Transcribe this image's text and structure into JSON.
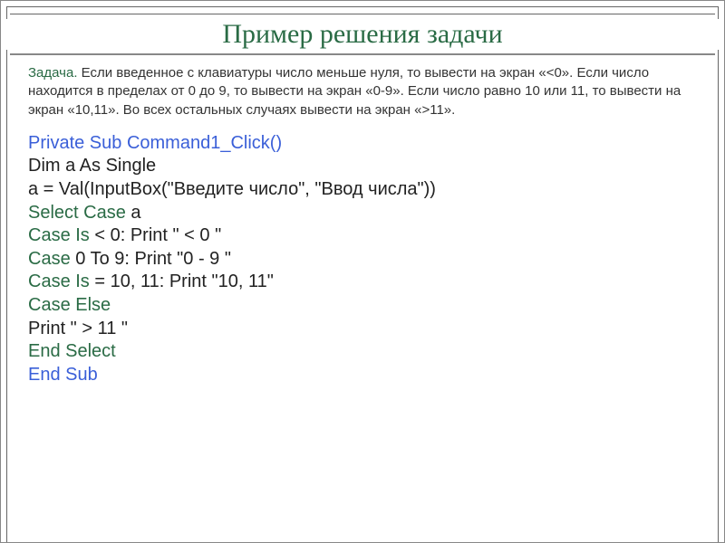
{
  "title": "Пример решения задачи",
  "task": {
    "label": "Задача.",
    "body": " Если введенное с клавиатуры число меньше нуля, то вывести на экран «<0». Если число находится в пределах от 0 до 9, то вывести на       экран «0-9». Если число равно 10 или 11, то вывести на экран «10,11».      Во всех остальных случаях вывести на экран «>11»."
  },
  "code": {
    "line1": "Private Sub Command1_Click()",
    "line2": "Dim a As Single",
    "line3": "a = Val(InputBox(\"Введите число\", \"Ввод числа\"))",
    "line4_a": "Select Case",
    "line4_b": " a",
    "line5_a": "Case Is",
    "line5_b": " < 0: Print \" < 0 \"",
    "line6_a": "Case",
    "line6_b": " 0 To 9: Print \"0 - 9 \"",
    "line7_a": "Case Is",
    "line7_b": " = 10, 11: Print \"10, 11\"",
    "line8": "Case Else",
    "line9": "Print \" > 11 \"",
    "line10": "End Select",
    "line11": "End Sub"
  }
}
